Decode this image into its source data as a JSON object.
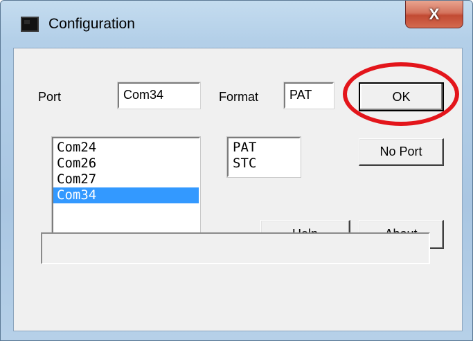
{
  "window": {
    "title": "Configuration",
    "close_label": "X"
  },
  "form": {
    "port_label": "Port",
    "port_value": "Com34",
    "format_label": "Format",
    "format_value": "PAT"
  },
  "buttons": {
    "ok": "OK",
    "no_port": "No Port",
    "help": "Help",
    "about": "About"
  },
  "port_list": {
    "items": [
      "Com24",
      "Com26",
      "Com27",
      "Com34"
    ],
    "selected": "Com34"
  },
  "format_list": {
    "items": [
      "PAT",
      "STC"
    ]
  },
  "progress": {
    "value": 0
  },
  "colors": {
    "selection": "#3399ff",
    "annotation_ring": "#e3151b"
  }
}
